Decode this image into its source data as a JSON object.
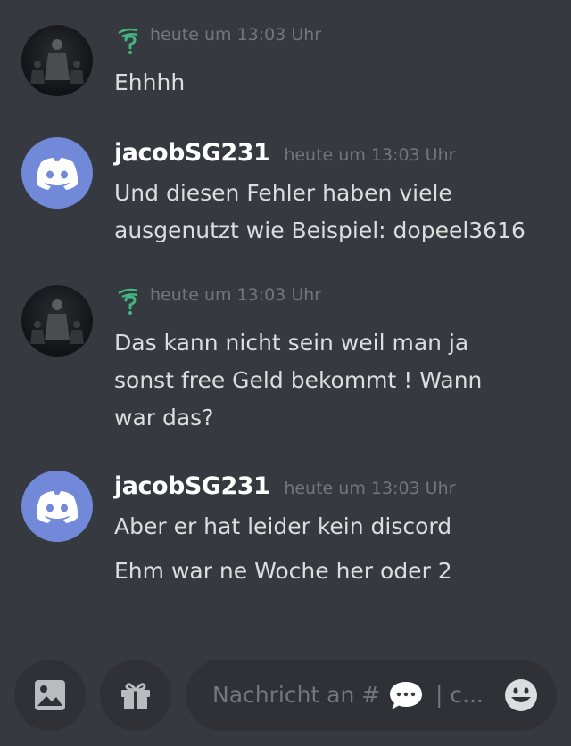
{
  "messages": [
    {
      "author": "",
      "author_icon": "green-question-emblem-icon",
      "timestamp": "heute um 13:03 Uhr",
      "avatar": "dark-photo-avatar",
      "lines": [
        "Ehhhh"
      ]
    },
    {
      "author": "jacobSG231",
      "timestamp": "heute um 13:03 Uhr",
      "avatar": "discord-default-avatar",
      "lines": [
        "Und diesen Fehler haben viele",
        "ausgenutzt wie Beispiel: dopeel3616"
      ]
    },
    {
      "author": "",
      "author_icon": "green-question-emblem-icon",
      "timestamp": "heute um 13:03 Uhr",
      "avatar": "dark-photo-avatar",
      "lines": [
        "Das kann nicht sein weil man ja",
        "sonst free Geld bekommt ! Wann",
        "war das?"
      ]
    },
    {
      "author": "jacobSG231",
      "timestamp": "heute um 13:03 Uhr",
      "avatar": "discord-default-avatar",
      "lines": [
        "Aber er hat leider kein discord",
        "Ehm war ne Woche her oder 2"
      ]
    }
  ],
  "composer": {
    "placeholder_prefix": "Nachricht an #",
    "placeholder_suffix": "| c...",
    "buttons": [
      "image-upload-icon",
      "gift-icon",
      "emoji-smile-icon"
    ]
  },
  "colors": {
    "background": "#36393f",
    "input_background": "#2f3136",
    "discord_blurple": "#7289da",
    "username": "#ffffff",
    "text": "#dcddde",
    "muted": "#72767d",
    "role_icon_green": "#43b581"
  }
}
